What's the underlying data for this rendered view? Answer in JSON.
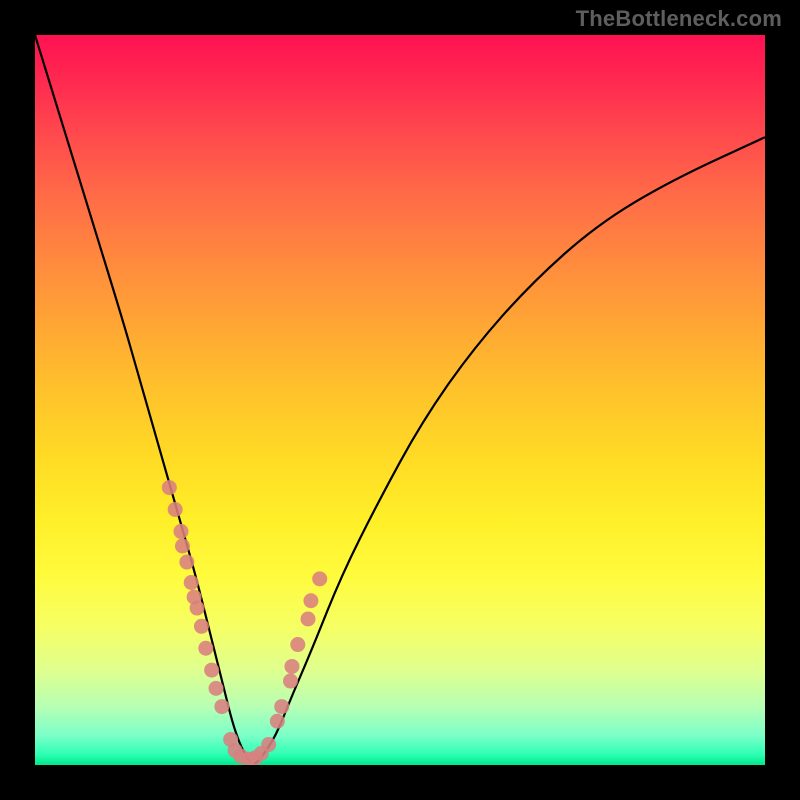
{
  "watermark": "TheBottleneck.com",
  "chart_data": {
    "type": "line",
    "title": "",
    "xlabel": "",
    "ylabel": "",
    "xlim": [
      0,
      100
    ],
    "ylim": [
      0,
      100
    ],
    "series": [
      {
        "name": "bottleneck-curve",
        "x": [
          0,
          4,
          8,
          12,
          14,
          16,
          18,
          20,
          22,
          24,
          25,
          26,
          27,
          28,
          29,
          30,
          31,
          33,
          35,
          38,
          42,
          47,
          53,
          60,
          68,
          77,
          87,
          100
        ],
        "y": [
          100,
          87,
          74,
          61,
          54,
          47,
          40,
          33,
          26,
          18,
          14,
          10,
          6,
          3,
          1,
          0,
          1,
          4,
          9,
          16,
          26,
          36,
          47,
          57,
          66,
          74,
          80,
          86
        ]
      }
    ],
    "markers": {
      "name": "sample-points",
      "points": [
        {
          "x": 18.4,
          "y": 38.0
        },
        {
          "x": 19.2,
          "y": 35.0
        },
        {
          "x": 20.0,
          "y": 32.0
        },
        {
          "x": 20.2,
          "y": 30.0
        },
        {
          "x": 20.8,
          "y": 27.8
        },
        {
          "x": 21.4,
          "y": 25.0
        },
        {
          "x": 21.8,
          "y": 23.0
        },
        {
          "x": 22.2,
          "y": 21.5
        },
        {
          "x": 22.8,
          "y": 19.0
        },
        {
          "x": 23.4,
          "y": 16.0
        },
        {
          "x": 24.2,
          "y": 13.0
        },
        {
          "x": 24.8,
          "y": 10.5
        },
        {
          "x": 25.6,
          "y": 8.0
        },
        {
          "x": 26.8,
          "y": 3.5
        },
        {
          "x": 27.4,
          "y": 2.0
        },
        {
          "x": 28.2,
          "y": 1.2
        },
        {
          "x": 29.2,
          "y": 0.8
        },
        {
          "x": 30.2,
          "y": 1.0
        },
        {
          "x": 31.0,
          "y": 1.6
        },
        {
          "x": 32.0,
          "y": 2.8
        },
        {
          "x": 33.2,
          "y": 6.0
        },
        {
          "x": 33.8,
          "y": 8.0
        },
        {
          "x": 35.0,
          "y": 11.5
        },
        {
          "x": 35.2,
          "y": 13.5
        },
        {
          "x": 36.0,
          "y": 16.5
        },
        {
          "x": 37.4,
          "y": 20.0
        },
        {
          "x": 37.8,
          "y": 22.5
        },
        {
          "x": 39.0,
          "y": 25.5
        }
      ]
    },
    "background_gradient": [
      "#ff1152",
      "#ffdb25",
      "#00e88c"
    ]
  }
}
